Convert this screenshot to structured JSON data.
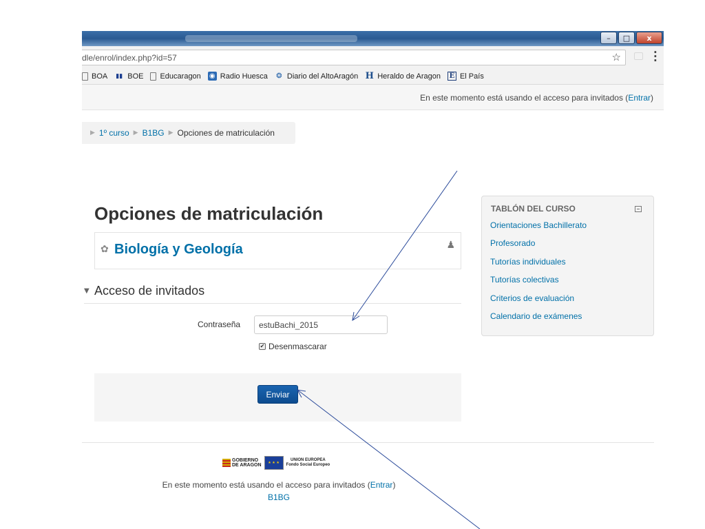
{
  "browser": {
    "url": "dle/enrol/index.php?id=57",
    "window_buttons": {
      "minimize": "–",
      "maximize": "□",
      "close": "x"
    },
    "bookmarks": [
      {
        "label": "BOA",
        "icon": "page-icon"
      },
      {
        "label": "BOE",
        "icon": "boe-icon"
      },
      {
        "label": "Educaragon",
        "icon": "page-icon"
      },
      {
        "label": "Radio Huesca",
        "icon": "radio-icon"
      },
      {
        "label": "Diario del AltoAragón",
        "icon": "diario-icon"
      },
      {
        "label": "Heraldo de Aragon",
        "icon": "heraldo-icon"
      },
      {
        "label": "El País",
        "icon": "pais-icon"
      }
    ]
  },
  "header": {
    "login_prefix": "En este momento está usando el acceso para invitados (",
    "login_link": "Entrar",
    "login_suffix": ")"
  },
  "breadcrumb": [
    {
      "label": "1º curso",
      "link": true
    },
    {
      "label": "B1BG",
      "link": true
    },
    {
      "label": "Opciones de matriculación",
      "link": false
    }
  ],
  "main": {
    "title": "Opciones de matriculación",
    "course_name": "Biología y Geología",
    "section_title": "Acceso de invitados",
    "password_label": "Contraseña",
    "password_value": "estuBachi_2015",
    "unmask_label": "Desenmascarar",
    "unmask_checked": true,
    "submit_label": "Enviar"
  },
  "block": {
    "title": "TABLÓN DEL CURSO",
    "links": [
      "Orientaciones Bachillerato",
      "Profesorado",
      "Tutorías individuales",
      "Tutorías colectivas",
      "Criterios de evaluación",
      "Calendario de exámenes"
    ]
  },
  "footer": {
    "gov_logo_line1": "GOBIERNO",
    "gov_logo_line2": "DE ARAGON",
    "eu_logo_line1": "UNION EUROPEA",
    "eu_logo_line2": "Fondo Social Europeo",
    "login_prefix": "En este momento está usando el acceso para invitados (",
    "login_link": "Entrar",
    "login_suffix": ")",
    "course_link": "B1BG"
  },
  "colors": {
    "link": "#0070a8",
    "button": "#0d4c8f",
    "annotation_arrow": "#2a4a9a"
  }
}
